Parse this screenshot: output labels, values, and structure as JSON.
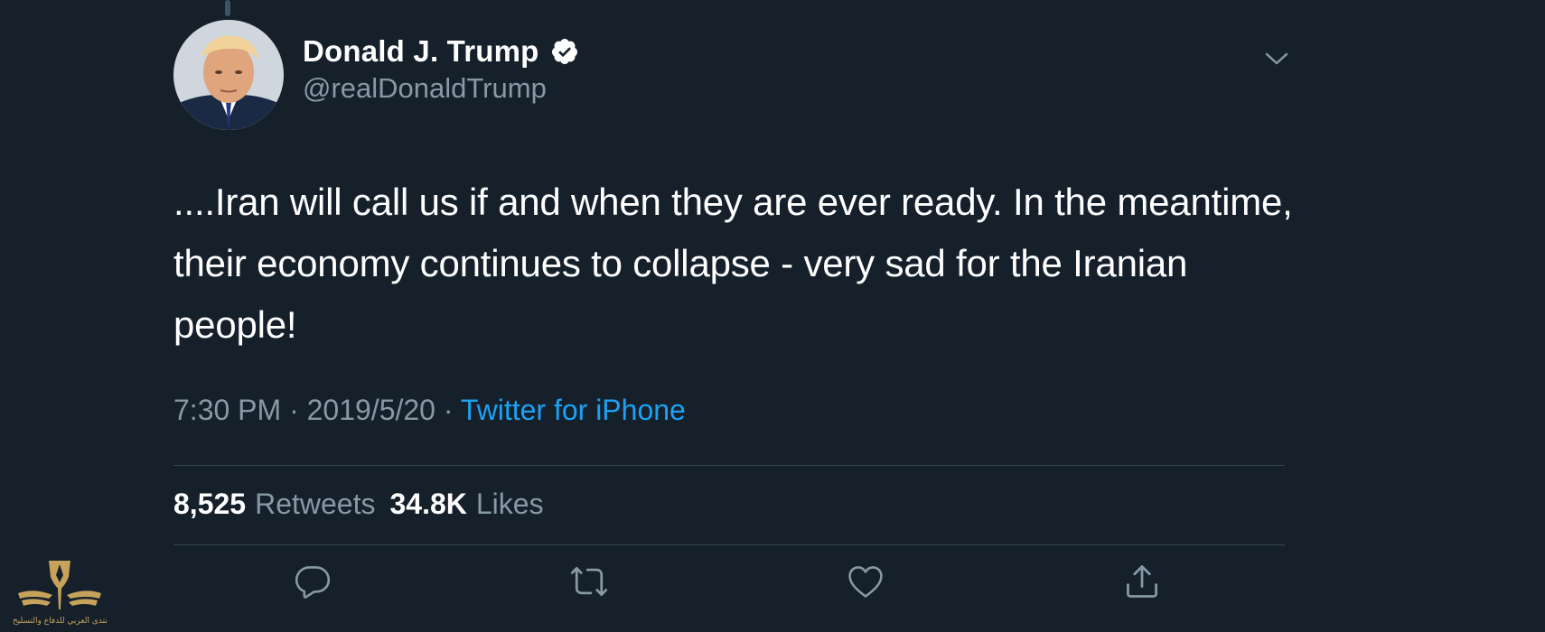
{
  "tweet": {
    "author": {
      "display_name": "Donald J. Trump",
      "handle": "@realDonaldTrump",
      "verified_icon": "verified-badge-icon",
      "avatar": "profile-avatar"
    },
    "text": "....Iran will call us if and when they are ever ready. In the meantime, their economy continues to collapse - very sad for the Iranian people!",
    "time": "7:30 PM",
    "date": "2019/5/20",
    "separator": "·",
    "source": "Twitter for iPhone",
    "stats": {
      "retweets_count": "8,525",
      "retweets_label": "Retweets",
      "likes_count": "34.8K",
      "likes_label": "Likes"
    }
  },
  "actions": [
    {
      "name": "reply",
      "icon": "reply-icon"
    },
    {
      "name": "retweet",
      "icon": "retweet-icon"
    },
    {
      "name": "like",
      "icon": "heart-icon"
    },
    {
      "name": "share",
      "icon": "share-icon"
    }
  ],
  "watermark": {
    "text": "المنتدى العربي للدفاع والتسليح"
  },
  "colors": {
    "background": "#15202b",
    "primary_text": "#ffffff",
    "secondary_text": "#8899a6",
    "link": "#1da1f2",
    "divider": "#38444d",
    "watermark": "#c7a25a"
  }
}
